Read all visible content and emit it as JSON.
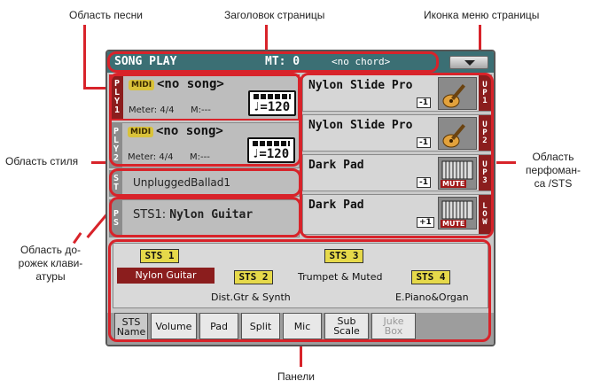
{
  "annotations": {
    "song_area": "Область песни",
    "page_header": "Заголовок страницы",
    "page_menu_icon": "Иконка меню страницы",
    "style_area": "Область стиля",
    "performance_area": [
      "Область",
      "перфоман-",
      "са /STS"
    ],
    "keyboard_tracks_area": [
      "Область до-",
      "рожек клави-",
      "атуры"
    ],
    "panels": "Панели"
  },
  "header": {
    "title": "SONG PLAY",
    "mt": "MT: 0",
    "chord": "<no chord>",
    "menu_icon": "chevron-down-icon"
  },
  "players": [
    {
      "tag": [
        "P",
        "L",
        "Y",
        "1"
      ],
      "midi": "MIDI",
      "song": "<no song>",
      "meter": "Meter: 4/4",
      "m": "M:---",
      "tempo": "♩=120"
    },
    {
      "tag": [
        "P",
        "L",
        "Y",
        "2"
      ],
      "midi": "MIDI",
      "song": "<no song>",
      "meter": "Meter: 4/4",
      "m": "M:---",
      "tempo": "♩=120"
    }
  ],
  "style": {
    "tag": [
      "S",
      "T"
    ],
    "name": "UnpluggedBallad1"
  },
  "performance": {
    "tag": [
      "P",
      "S"
    ],
    "label": "STS1:",
    "name": "Nylon Guitar"
  },
  "sounds": [
    {
      "name": "Nylon Slide Pro",
      "octave": "-1",
      "icon": "guitar-icon",
      "tag": [
        "U",
        "P",
        "1"
      ],
      "mute": ""
    },
    {
      "name": "Nylon Slide Pro",
      "octave": "-1",
      "icon": "guitar-icon",
      "tag": [
        "U",
        "P",
        "2"
      ],
      "mute": ""
    },
    {
      "name": "Dark Pad",
      "octave": "-1",
      "icon": "keyboard-icon",
      "tag": [
        "U",
        "P",
        "3"
      ],
      "mute": "MUTE"
    },
    {
      "name": "Dark Pad",
      "octave": "+1",
      "icon": "keyboard-icon",
      "tag": [
        "L",
        "O",
        "W"
      ],
      "mute": "MUTE"
    }
  ],
  "sts": {
    "buttons": [
      "STS 1",
      "STS 2",
      "STS 3",
      "STS 4"
    ],
    "names": [
      "Nylon Guitar",
      "Dist.Gtr & Synth",
      "Trumpet & Muted",
      "E.Piano&Organ"
    ]
  },
  "tabs": [
    {
      "label": [
        "STS",
        "Name"
      ],
      "selected": true,
      "disabled": false
    },
    {
      "label": [
        "Volume"
      ],
      "selected": false,
      "disabled": false
    },
    {
      "label": [
        "Pad"
      ],
      "selected": false,
      "disabled": false
    },
    {
      "label": [
        "Split"
      ],
      "selected": false,
      "disabled": false
    },
    {
      "label": [
        "Mic"
      ],
      "selected": false,
      "disabled": false
    },
    {
      "label": [
        "Sub",
        "Scale"
      ],
      "selected": false,
      "disabled": false
    },
    {
      "label": [
        "Juke",
        "Box"
      ],
      "selected": false,
      "disabled": true
    }
  ],
  "colors": {
    "accent_red": "#d8232a",
    "header_teal": "#3b6f74",
    "tag_red": "#8b1d1d",
    "sts_yellow": "#e6d94a"
  }
}
